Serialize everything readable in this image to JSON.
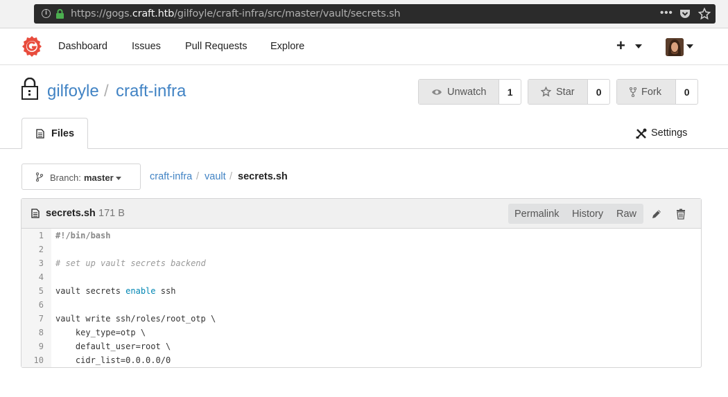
{
  "browser": {
    "url_prefix": "https://gogs.",
    "url_domain": "craft.htb",
    "url_path": "/gilfoyle/craft-infra/src/master/vault/secrets.sh",
    "menu_dots": "•••"
  },
  "nav": {
    "items": [
      "Dashboard",
      "Issues",
      "Pull Requests",
      "Explore"
    ],
    "plus": "+"
  },
  "repo": {
    "owner": "gilfoyle",
    "separator": "/",
    "name": "craft-infra",
    "unwatch_label": "Unwatch",
    "watch_count": "1",
    "star_label": "Star",
    "star_count": "0",
    "fork_label": "Fork",
    "fork_count": "0",
    "tab_files": "Files",
    "tab_settings": "Settings"
  },
  "branch": {
    "label": "Branch:",
    "value": "master"
  },
  "breadcrumb": {
    "items": [
      "craft-infra",
      "vault",
      "secrets.sh"
    ],
    "separator": "/"
  },
  "file": {
    "name": "secrets.sh",
    "size": "171 B",
    "buttons": [
      "Permalink",
      "History",
      "Raw"
    ],
    "lines": [
      {
        "n": "1",
        "parts": [
          {
            "t": "#!/bin/bash",
            "c": "shebang"
          }
        ]
      },
      {
        "n": "2",
        "parts": [
          {
            "t": "",
            "c": ""
          }
        ]
      },
      {
        "n": "3",
        "parts": [
          {
            "t": "# set up vault secrets backend",
            "c": "comment"
          }
        ]
      },
      {
        "n": "4",
        "parts": [
          {
            "t": "",
            "c": ""
          }
        ]
      },
      {
        "n": "5",
        "parts": [
          {
            "t": "vault secrets ",
            "c": ""
          },
          {
            "t": "enable",
            "c": "kw"
          },
          {
            "t": " ssh",
            "c": ""
          }
        ]
      },
      {
        "n": "6",
        "parts": [
          {
            "t": "",
            "c": ""
          }
        ]
      },
      {
        "n": "7",
        "parts": [
          {
            "t": "vault write ssh/roles/root_otp \\",
            "c": ""
          }
        ]
      },
      {
        "n": "8",
        "parts": [
          {
            "t": "    key_type=otp \\",
            "c": ""
          }
        ]
      },
      {
        "n": "9",
        "parts": [
          {
            "t": "    default_user=root \\",
            "c": ""
          }
        ]
      },
      {
        "n": "10",
        "parts": [
          {
            "t": "    cidr_list=0.0.0.0/0",
            "c": ""
          }
        ]
      }
    ]
  },
  "colors": {
    "link": "#4183c4",
    "keyword": "#0086b3",
    "logo": "#e84c3d"
  }
}
